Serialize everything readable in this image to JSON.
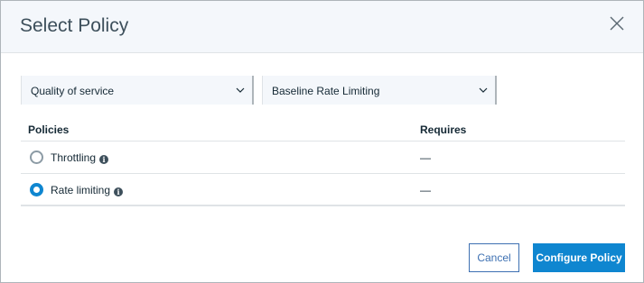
{
  "dialog": {
    "title": "Select Policy",
    "close_icon": "close-icon"
  },
  "filters": {
    "category": {
      "value": "Quality of service",
      "icon": "chevron-down-icon"
    },
    "policy_set": {
      "value": "Baseline Rate Limiting",
      "icon": "chevron-down-icon"
    }
  },
  "table": {
    "headers": {
      "policies": "Policies",
      "requires": "Requires"
    },
    "rows": [
      {
        "name": "Throttling",
        "requires": "—",
        "selected": false,
        "icon": "info-icon"
      },
      {
        "name": "Rate limiting",
        "requires": "—",
        "selected": true,
        "icon": "info-icon"
      }
    ]
  },
  "footer": {
    "cancel_label": "Cancel",
    "configure_label": "Configure Policy"
  },
  "colors": {
    "primary": "#0f86d0",
    "header_bg": "#f4f7fb",
    "text": "#152935"
  }
}
